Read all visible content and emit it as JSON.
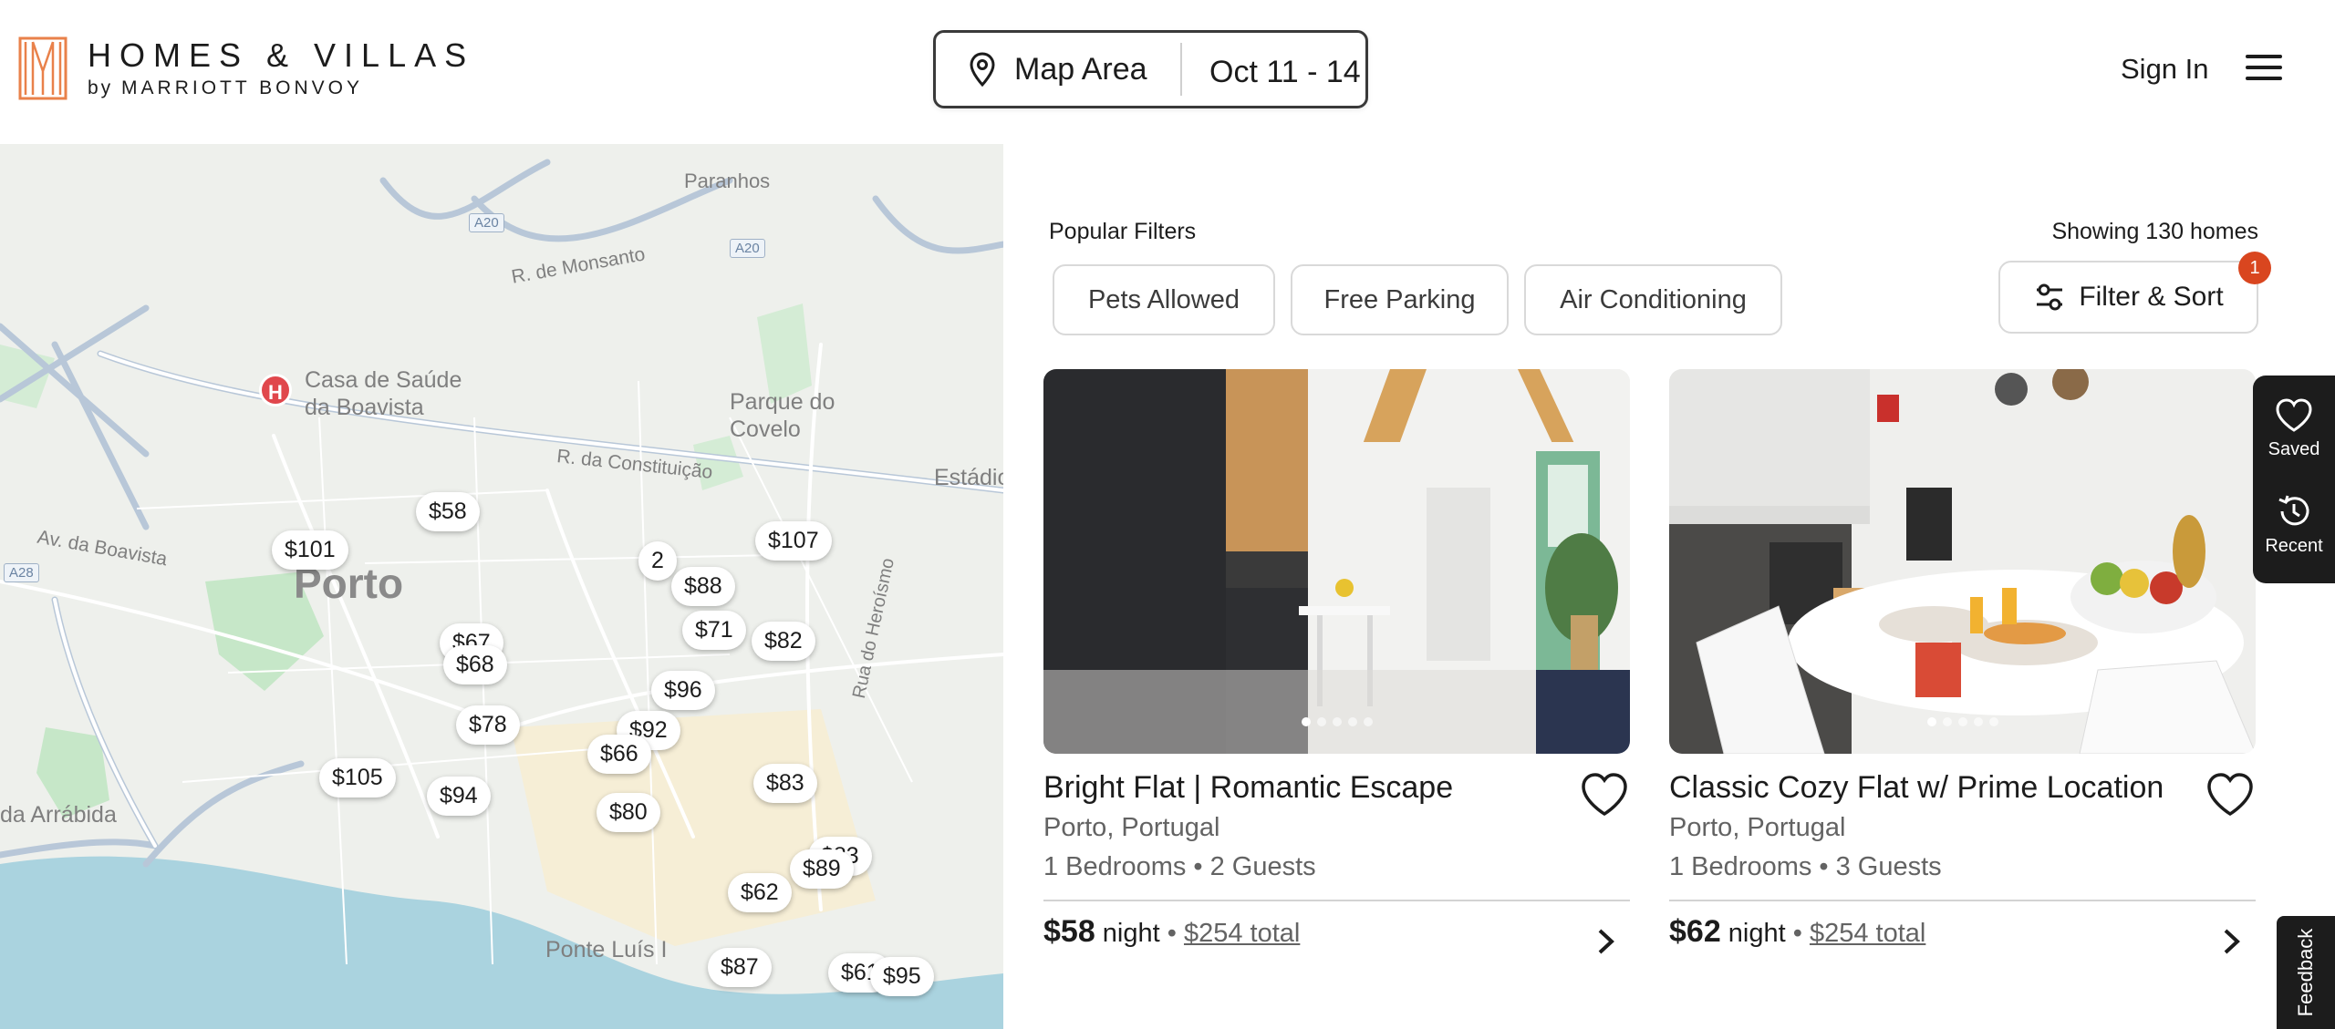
{
  "brand": {
    "title": "HOMES & VILLAS",
    "sub_prefix": "by",
    "sub_name": "MARRIOTT BONVOY"
  },
  "search": {
    "area": "Map Area",
    "dates": "Oct 11 - 14"
  },
  "header": {
    "sign_in": "Sign In"
  },
  "map": {
    "city": "Porto",
    "labels": [
      "Casa de Saúde\nda Boavista",
      "Parque do\nCovelo",
      "R. de Monsanto",
      "R. da Constituição",
      "Av. da Boavista",
      "Estádio",
      "Paranhos",
      "da Arrábida",
      "Ponte Luís I",
      "Rua do Heroísmo"
    ],
    "roads": [
      "A20",
      "A20",
      "A28"
    ],
    "cluster": "2",
    "pins": [
      "$58",
      "$101",
      "$107",
      "$88",
      "$71",
      "$82",
      "$67",
      "$68",
      "$96",
      "$78",
      "$92",
      "$66",
      "$83",
      "$105",
      "$94",
      "$80",
      "$83",
      "$89",
      "$62",
      "$87",
      "$61",
      "$95"
    ]
  },
  "results": {
    "popular_filters": "Popular Filters",
    "showing": "Showing 130 homes",
    "filters": [
      "Pets Allowed",
      "Free Parking",
      "Air Conditioning"
    ],
    "filter_sort": "Filter & Sort",
    "filter_count": "1"
  },
  "listings": [
    {
      "title": "Bright Flat | Romantic Escape",
      "location": "Porto, Portugal",
      "meta": "1 Bedrooms • 2 Guests",
      "price": "$58",
      "unit": "night",
      "total": "$254 total"
    },
    {
      "title": "Classic Cozy Flat w/ Prime Location",
      "location": "Porto, Portugal",
      "meta": "1 Bedrooms • 3 Guests",
      "price": "$62",
      "unit": "night",
      "total": "$254 total"
    }
  ],
  "tools": {
    "saved": "Saved",
    "recent": "Recent"
  },
  "feedback": "Feedback",
  "colors": {
    "logo_orange": "#e9814a",
    "badge": "#d9461f",
    "hospital": "#e0474c",
    "map_bg": "#eef0ec",
    "river": "#aad3df",
    "park": "#c6e7c8"
  }
}
